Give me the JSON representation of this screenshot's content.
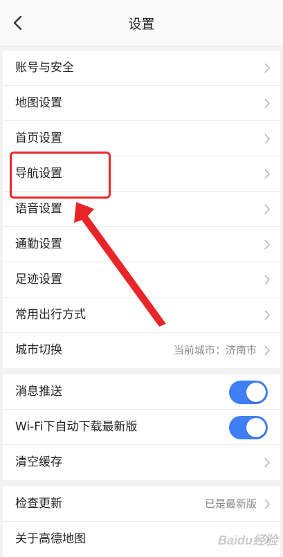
{
  "header": {
    "title": "设置",
    "back_icon": "chevron-left-icon"
  },
  "group1": {
    "items": [
      {
        "label": "账号与安全"
      },
      {
        "label": "地图设置"
      },
      {
        "label": "首页设置"
      },
      {
        "label": "导航设置"
      },
      {
        "label": "语音设置"
      },
      {
        "label": "通勤设置"
      },
      {
        "label": "足迹设置"
      },
      {
        "label": "常用出行方式"
      },
      {
        "label": "城市切换",
        "value": "当前城市：济南市"
      }
    ]
  },
  "group2": {
    "items": [
      {
        "label": "消息推送",
        "toggle": true
      },
      {
        "label": "Wi-Fi下自动下载最新版",
        "toggle": true
      },
      {
        "label": "清空缓存"
      }
    ]
  },
  "group3": {
    "items": [
      {
        "label": "检查更新",
        "value": "已是最新版"
      },
      {
        "label": "关于高德地图"
      }
    ]
  },
  "watermark": {
    "text": "Baidu经验"
  },
  "colors": {
    "toggle_on": "#3f7ef5",
    "annotation": "#e8262a"
  }
}
